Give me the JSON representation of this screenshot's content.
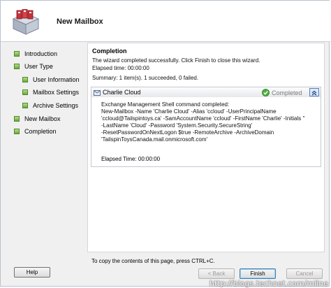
{
  "header": {
    "title": "New Mailbox",
    "icon": "mailbox-icon"
  },
  "nav": {
    "items": [
      {
        "label": "Introduction",
        "level": 0
      },
      {
        "label": "User Type",
        "level": 0
      },
      {
        "label": "User Information",
        "level": 1
      },
      {
        "label": "Mailbox Settings",
        "level": 1
      },
      {
        "label": "Archive Settings",
        "level": 1
      },
      {
        "label": "New Mailbox",
        "level": 0
      },
      {
        "label": "Completion",
        "level": 0
      }
    ],
    "item_color": "#6aa83c"
  },
  "content": {
    "title": "Completion",
    "message": "The wizard completed successfully. Click Finish to close this wizard.",
    "elapsed": "Elapsed time: 00:00:00",
    "summary": "Summary: 1 item(s). 1 succeeded, 0 failed.",
    "task": {
      "name": "Charlie Cloud",
      "status": "Completed",
      "command": "Exchange Management Shell command completed:\nNew-Mailbox -Name 'Charlie Cloud' -Alias 'ccloud' -UserPrincipalName\n'ccloud@Tailspintoys.ca' -SamAccountName 'ccloud' -FirstName 'Charlie' -Initials ''\n-LastName 'Cloud' -Password 'System.Security.SecureString'\n-ResetPasswordOnNextLogon $true -RemoteArchive -ArchiveDomain\n'TailspinToysCanada.mail.onmicrosoft.com'",
      "elapsed": "Elapsed Time: 00:00:00",
      "status_color": "#3c9a2e"
    }
  },
  "footer": {
    "copy_hint": "To copy the contents of this page, press CTRL+C.",
    "help_label": "Help",
    "back_label": "< Back",
    "finish_label": "Finish",
    "cancel_label": "Cancel"
  },
  "watermark": "http://blogs.technet.com/mllne"
}
